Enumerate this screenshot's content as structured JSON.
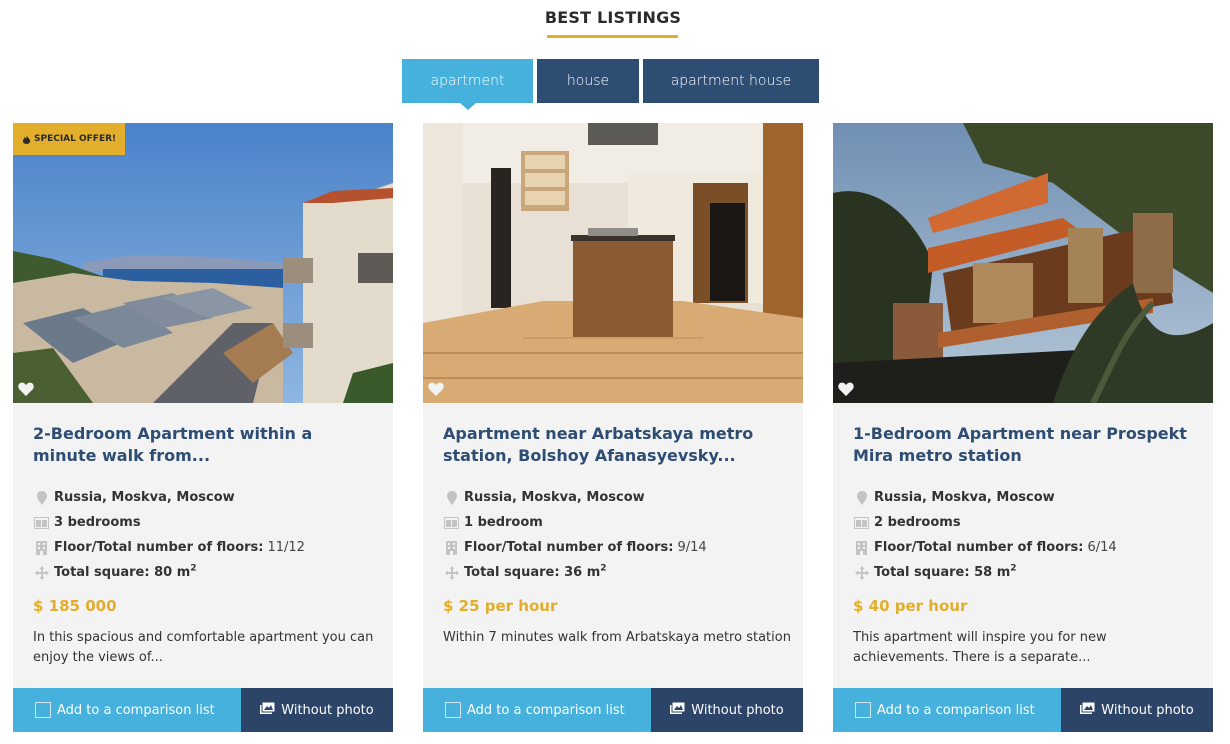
{
  "section": {
    "title": "BEST LISTINGS"
  },
  "tabs": [
    {
      "label": "apartment",
      "active": true
    },
    {
      "label": "house",
      "active": false
    },
    {
      "label": "apartment house",
      "active": false
    }
  ],
  "labels": {
    "floors": "Floor/Total number of floors:",
    "square": "Total square:",
    "unit": "m",
    "unit_sup": "2",
    "compare": "Add to a comparison list",
    "without_photo": "Without photo"
  },
  "colors": {
    "accent_blue": "#45b1dc",
    "navy": "#2e4d73",
    "gold": "#e2ae2c"
  },
  "listings": [
    {
      "badge": "SPECIAL OFFER!",
      "title": "2-Bedroom Apartment within a minute walk from...",
      "location": "Russia, Moskva, Moscow",
      "bedrooms": "3 bedrooms",
      "floors": "11/12",
      "square": "80",
      "price": "$ 185 000",
      "description": "In this spacious and comfortable apartment you can enjoy the views of..."
    },
    {
      "title": "Apartment near Arbatskaya metro station, Bolshoy Afanasyevsky...",
      "location": "Russia, Moskva, Moscow",
      "bedrooms": "1 bedroom",
      "floors": "9/14",
      "square": "36",
      "price": "$ 25 per hour",
      "description": "Within 7 minutes walk from Arbatskaya metro station"
    },
    {
      "title": "1-Bedroom Apartment near Prospekt Mira metro station",
      "location": "Russia, Moskva, Moscow",
      "bedrooms": "2 bedrooms",
      "floors": "6/14",
      "square": "58",
      "price": "$ 40 per hour",
      "description": "This apartment will inspire you for new achievements. There is a separate..."
    }
  ]
}
